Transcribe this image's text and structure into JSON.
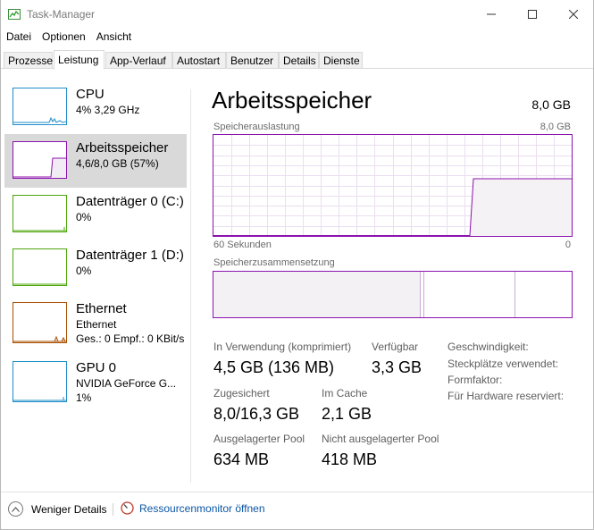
{
  "window": {
    "title": "Task-Manager"
  },
  "menu": {
    "items": [
      "Datei",
      "Optionen",
      "Ansicht"
    ]
  },
  "tabs": [
    {
      "label": "Prozesse",
      "active": false
    },
    {
      "label": "Leistung",
      "active": true
    },
    {
      "label": "App-Verlauf",
      "active": false
    },
    {
      "label": "Autostart",
      "active": false
    },
    {
      "label": "Benutzer",
      "active": false
    },
    {
      "label": "Details",
      "active": false
    },
    {
      "label": "Dienste",
      "active": false
    }
  ],
  "sidebar": {
    "items": [
      {
        "title": "CPU",
        "sub1": "4% 3,29 GHz",
        "sub2": "",
        "sub3": "",
        "selected": false,
        "color": "#1f8ec9"
      },
      {
        "title": "Arbeitsspeicher",
        "sub1": "4,6/8,0 GB (57%)",
        "sub2": "",
        "sub3": "",
        "selected": true,
        "color": "#8b12ae"
      },
      {
        "title": "Datenträger 0 (C:)",
        "sub1": "0%",
        "sub2": "",
        "sub3": "",
        "selected": false,
        "color": "#4da60c"
      },
      {
        "title": "Datenträger 1 (D:)",
        "sub1": "0%",
        "sub2": "",
        "sub3": "",
        "selected": false,
        "color": "#4da60c"
      },
      {
        "title": "Ethernet",
        "sub1": "Ethernet",
        "sub2": "Ges.: 0 Empf.: 0 KBit/s",
        "sub3": "",
        "selected": false,
        "color": "#a74f01"
      },
      {
        "title": "GPU 0",
        "sub1": "NVIDIA GeForce G...",
        "sub2": "1%",
        "sub3": "",
        "selected": false,
        "color": "#1f8ec9"
      }
    ]
  },
  "memory": {
    "heading": "Arbeitsspeicher",
    "total": "8,0 GB",
    "usage_chart": {
      "label": "Speicherauslastung",
      "max_label": "8,0 GB",
      "time_label": "60 Sekunden",
      "min_label": "0",
      "current_fraction": 0.57
    },
    "composition": {
      "label": "Speicherzusammensetzung"
    },
    "stats": {
      "in_use_label": "In Verwendung (komprimiert)",
      "in_use_value": "4,5 GB (136 MB)",
      "available_label": "Verfügbar",
      "available_value": "3,3 GB",
      "committed_label": "Zugesichert",
      "committed_value": "8,0/16,3 GB",
      "cached_label": "Im Cache",
      "cached_value": "2,1 GB",
      "paged_label": "Ausgelagerter Pool",
      "paged_value": "634 MB",
      "nonpaged_label": "Nicht ausgelagerter Pool",
      "nonpaged_value": "418 MB"
    },
    "details": {
      "speed": "Geschwindigkeit:",
      "slots": "Steckplätze verwendet:",
      "form": "Formfaktor:",
      "reserved": "Für Hardware reserviert:"
    }
  },
  "footer": {
    "fewer_details": "Weniger Details",
    "resource_monitor": "Ressourcenmonitor öffnen"
  },
  "colors": {
    "memory_accent": "#8b12ae",
    "memory_fill": "#f4f2f4",
    "link": "#0a56a5"
  }
}
